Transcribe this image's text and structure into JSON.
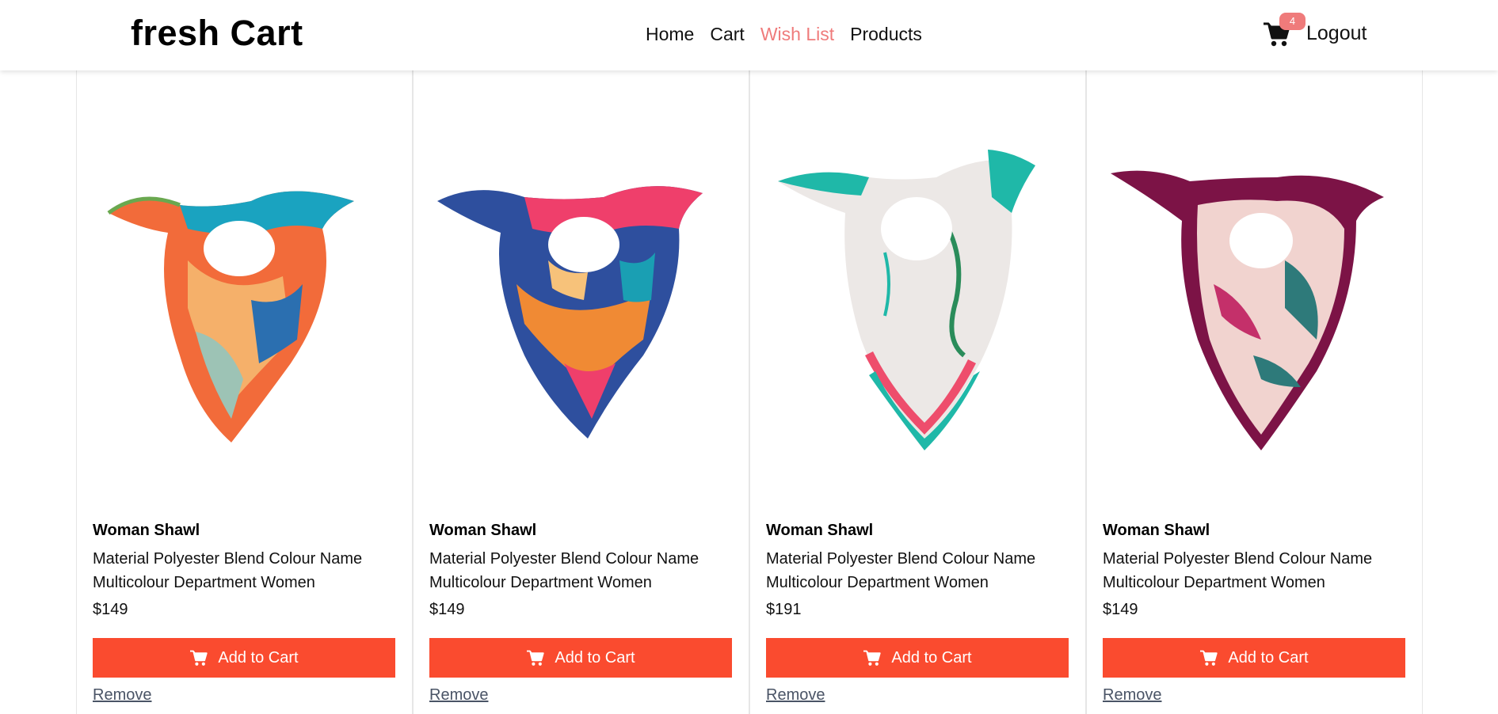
{
  "brand": "fresh Cart",
  "nav": {
    "links": [
      {
        "label": "Home",
        "active": false
      },
      {
        "label": "Cart",
        "active": false
      },
      {
        "label": "Wish List",
        "active": true
      },
      {
        "label": "Products",
        "active": false
      }
    ],
    "cart_count": "4",
    "cart_icon": "cart-icon",
    "logout_label": "Logout"
  },
  "colors": {
    "accent": "#ef7b7b",
    "button": "#fa4b2f",
    "remove_link": "#4a5466"
  },
  "products": [
    {
      "title": "Woman Shawl",
      "description": "Material Polyester Blend Colour Name Multicolour Department Women",
      "price": "$149",
      "add_label": "Add to Cart",
      "remove_label": "Remove",
      "image_icon": "scarf-image",
      "palette": [
        "#f26b3a",
        "#1aa3c0",
        "#f5b06a",
        "#2b6fb0",
        "#9dc3b5"
      ]
    },
    {
      "title": "Woman Shawl",
      "description": "Material Polyester Blend Colour Name Multicolour Department Women",
      "price": "$149",
      "add_label": "Add to Cart",
      "remove_label": "Remove",
      "image_icon": "scarf-image",
      "palette": [
        "#2e4f9e",
        "#ef3f6b",
        "#f08a34",
        "#1a9fb3",
        "#f7c27a"
      ]
    },
    {
      "title": "Woman Shawl",
      "description": "Material Polyester Blend Colour Name Multicolour Department Women",
      "price": "$191",
      "add_label": "Add to Cart",
      "remove_label": "Remove",
      "image_icon": "scarf-image",
      "palette": [
        "#ece8e6",
        "#1fb8a8",
        "#ee4d6c",
        "#2a8c5a",
        "#d9d2cf"
      ]
    },
    {
      "title": "Woman Shawl",
      "description": "Material Polyester Blend Colour Name Multicolour Department Women",
      "price": "$149",
      "add_label": "Add to Cart",
      "remove_label": "Remove",
      "image_icon": "scarf-image",
      "palette": [
        "#7c1346",
        "#f1d3cf",
        "#2e7a7a",
        "#c4306a",
        "#e9b7b9"
      ]
    }
  ]
}
